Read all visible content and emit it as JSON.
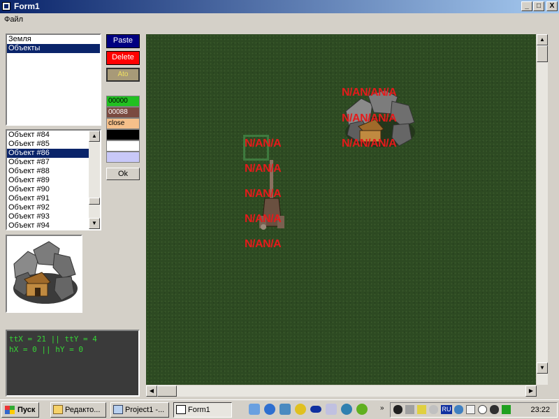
{
  "window": {
    "title": "Form1"
  },
  "titlebar_buttons": {
    "minimize": "_",
    "maximize": "□",
    "close": "X"
  },
  "menu": {
    "file": "Файл"
  },
  "layers_list": {
    "items": [
      "Земля",
      "Объекты"
    ],
    "selected_index": 1
  },
  "objects_list": {
    "items": [
      "Объект #84",
      "Объект #85",
      "Объект #86",
      "Объект #87",
      "Объект #88",
      "Объект #89",
      "Объект #90",
      "Объект #91",
      "Объект #92",
      "Объект #93",
      "Объект #94"
    ],
    "selected_index": 2
  },
  "actions": {
    "paste": "Paste",
    "delete": "Delete",
    "third": "Ato"
  },
  "swatches": {
    "s1": "00000",
    "s2": "00088",
    "s3": "close",
    "s4": "",
    "s5": "",
    "s6": ""
  },
  "ok_label": "Ok",
  "console": {
    "line1": "ttX = 21 || ttY = 4",
    "line2": "hX = 0 || hY = 0"
  },
  "map_labels": {
    "text": "N/A"
  },
  "taskbar": {
    "start": "Пуск",
    "tasks": [
      "Редакто...",
      "Project1 -...",
      "Form1"
    ],
    "tray_lang": "RU",
    "clock": "23:22"
  },
  "colors": {
    "accent": "#0a246a",
    "paste_bg": "#000080",
    "delete_bg": "#ff0000",
    "label_red": "#e41b1b",
    "console_text": "#36d636"
  }
}
